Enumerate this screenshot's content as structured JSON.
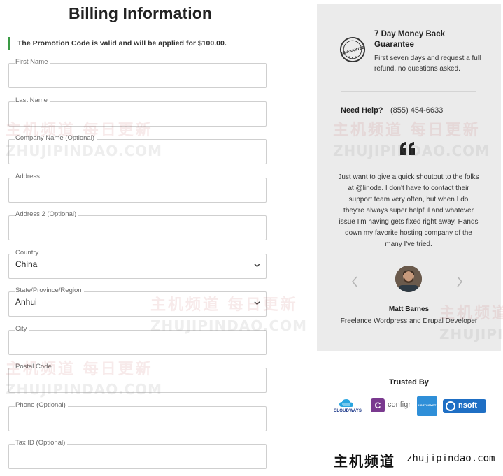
{
  "title": "Billing Information",
  "promo_message": "The Promotion Code is valid and will be applied for $100.00.",
  "fields": [
    {
      "label": "First Name",
      "value": ""
    },
    {
      "label": "Last Name",
      "value": ""
    },
    {
      "label": "Company Name (Optional)",
      "value": ""
    },
    {
      "label": "Address",
      "value": ""
    },
    {
      "label": "Address 2 (Optional)",
      "value": ""
    },
    {
      "label": "Country",
      "value": "China"
    },
    {
      "label": "State/Province/Region",
      "value": "Anhui"
    },
    {
      "label": "City",
      "value": ""
    },
    {
      "label": "Postal Code",
      "value": ""
    },
    {
      "label": "Phone (Optional)",
      "value": ""
    },
    {
      "label": "Tax ID (Optional)",
      "value": ""
    }
  ],
  "guarantee": {
    "badge_text": "GUARANTEE",
    "title": "7 Day Money Back Guarantee",
    "description": "First seven days and request a full refund, no questions asked."
  },
  "help": {
    "label": "Need Help?",
    "phone": "(855) 454-6633"
  },
  "testimonial": {
    "quote": "Just want to give a quick shoutout to the folks at @linode. I don't have to contact their support team very often, but when I do they're always super helpful and whatever issue I'm having gets fixed right away. Hands down my favorite hosting company of the many I've tried.",
    "author": "Matt Barnes",
    "role": "Freelance Wordpress and Drupal Developer"
  },
  "trusted": {
    "heading": "Trusted By",
    "logos": [
      {
        "name": "cloudways",
        "text": "CLOUDWAYS"
      },
      {
        "name": "configr",
        "text": "configr",
        "mark": "C"
      },
      {
        "name": "hostcomet",
        "text": "HOSTCOMET"
      },
      {
        "name": "nsoft",
        "text": "nsoft"
      }
    ]
  },
  "watermark": {
    "cn_text": "主机频道 每日更新",
    "en_text": "ZHUJIPINDAO.COM",
    "site_cn": "主机频道",
    "site_en": "zhujipindao.com"
  },
  "colors": {
    "promo_accent": "#3a9a44",
    "panel_bg": "#ebebeb",
    "field_border": "#cfcfcf"
  },
  "icons": [
    "guarantee-badge-icon",
    "quote-icon",
    "chevron-down-icon",
    "arrow-left-icon",
    "arrow-right-icon"
  ]
}
